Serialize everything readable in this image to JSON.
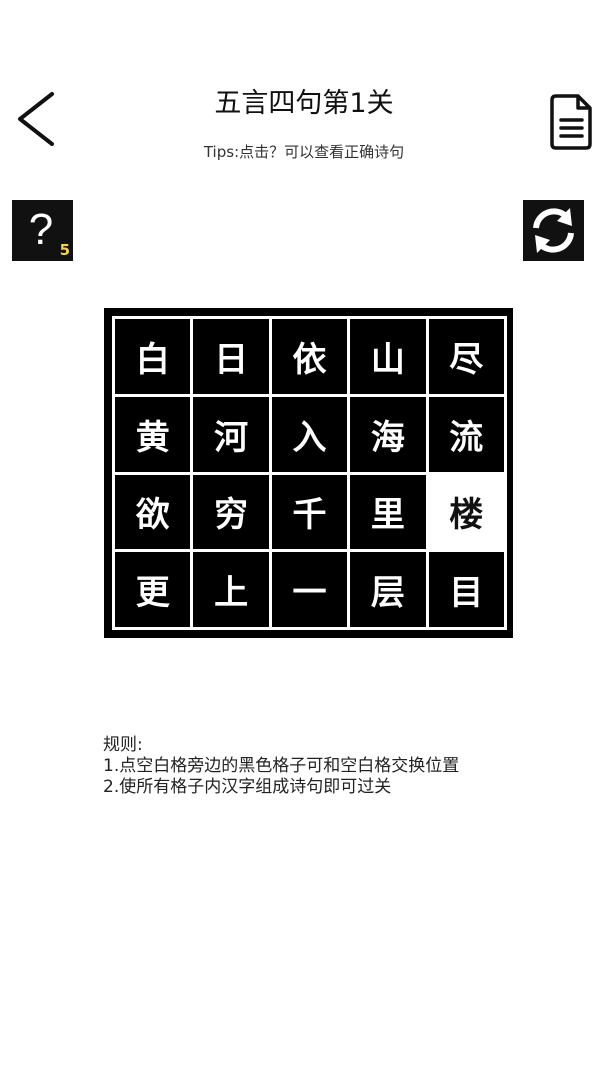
{
  "header": {
    "title": "五言四句第1关",
    "tips": "Tips:点击？可以查看正确诗句"
  },
  "icons": {
    "back": "chevron-left-icon",
    "document": "document-icon",
    "hint": "question-mark-icon",
    "refresh": "refresh-icon"
  },
  "hint": {
    "symbol": "?",
    "count": "5",
    "count_color": "#f2d24b"
  },
  "board": {
    "rows": [
      [
        {
          "char": "白",
          "blank": false
        },
        {
          "char": "日",
          "blank": false
        },
        {
          "char": "依",
          "blank": false
        },
        {
          "char": "山",
          "blank": false
        },
        {
          "char": "尽",
          "blank": false
        }
      ],
      [
        {
          "char": "黄",
          "blank": false
        },
        {
          "char": "河",
          "blank": false
        },
        {
          "char": "入",
          "blank": false
        },
        {
          "char": "海",
          "blank": false
        },
        {
          "char": "流",
          "blank": false
        }
      ],
      [
        {
          "char": "欲",
          "blank": false
        },
        {
          "char": "穷",
          "blank": false
        },
        {
          "char": "千",
          "blank": false
        },
        {
          "char": "里",
          "blank": false
        },
        {
          "char": "楼",
          "blank": true
        }
      ],
      [
        {
          "char": "更",
          "blank": false
        },
        {
          "char": "上",
          "blank": false
        },
        {
          "char": "一",
          "blank": false
        },
        {
          "char": "层",
          "blank": false
        },
        {
          "char": "目",
          "blank": false
        }
      ]
    ],
    "tile_color": "#000000",
    "blank_color": "#ffffff"
  },
  "rules": {
    "heading": "规则:",
    "line1": "1.点空白格旁边的黑色格子可和空白格交换位置",
    "line2": "2.使所有格子内汉字组成诗句即可过关"
  }
}
